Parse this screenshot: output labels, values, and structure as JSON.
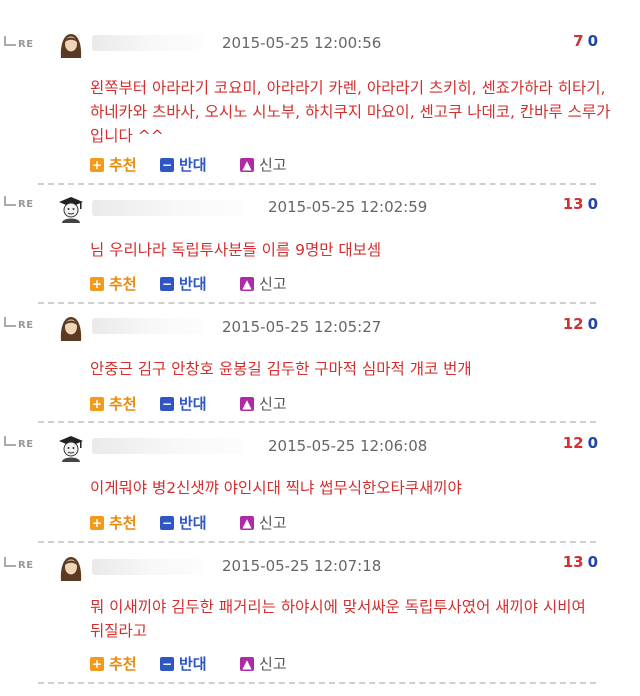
{
  "comments": [
    {
      "reply_tag": "RE",
      "avatar": "woman-avatar",
      "date": "2015-05-25 12:00:56",
      "votes_up": "7",
      "votes_down": "0",
      "text": "왼쪽부터 아라라기 코요미, 아라라기 카렌, 아라라기 츠키히, 센죠가하라 히타기, 하네카와 츠바사, 오시노 시노부, 하치쿠지 마요이, 센고쿠 나데코, 칸바루 스루가 입니다 ^^",
      "recommend": "추천",
      "oppose": "반대",
      "report": "신고"
    },
    {
      "reply_tag": "RE",
      "avatar": "graduate-avatar",
      "date": "2015-05-25 12:02:59",
      "votes_up": "13",
      "votes_down": "0",
      "text": "님 우리나라 독립투사분들 이름 9명만 대보셈",
      "recommend": "추천",
      "oppose": "반대",
      "report": "신고"
    },
    {
      "reply_tag": "RE",
      "avatar": "woman-avatar",
      "date": "2015-05-25 12:05:27",
      "votes_up": "12",
      "votes_down": "0",
      "text": "안중근 김구 안창호 윤봉길 김두한 구마적 심마적 개코 번개",
      "recommend": "추천",
      "oppose": "반대",
      "report": "신고"
    },
    {
      "reply_tag": "RE",
      "avatar": "graduate-avatar",
      "date": "2015-05-25 12:06:08",
      "votes_up": "12",
      "votes_down": "0",
      "text": "이게뭐야 병2신샛꺄 야인시대 찍냐 썹무식한오타쿠새끼야",
      "recommend": "추천",
      "oppose": "반대",
      "report": "신고"
    },
    {
      "reply_tag": "RE",
      "avatar": "woman-avatar",
      "date": "2015-05-25 12:07:18",
      "votes_up": "13",
      "votes_down": "0",
      "text": "뭐 이새끼야 김두한 패거리는 하야시에 맞서싸운 독립투사였어 새끼야 시비여 뒤질라고",
      "recommend": "추천",
      "oppose": "반대",
      "report": "신고"
    }
  ],
  "colors": {
    "comment_text": "#d32f2f",
    "vote_up": "#d23131",
    "vote_down": "#2244a8",
    "recommend": "#f29a1b",
    "oppose": "#2f57c4",
    "report": "#b02aa6"
  }
}
